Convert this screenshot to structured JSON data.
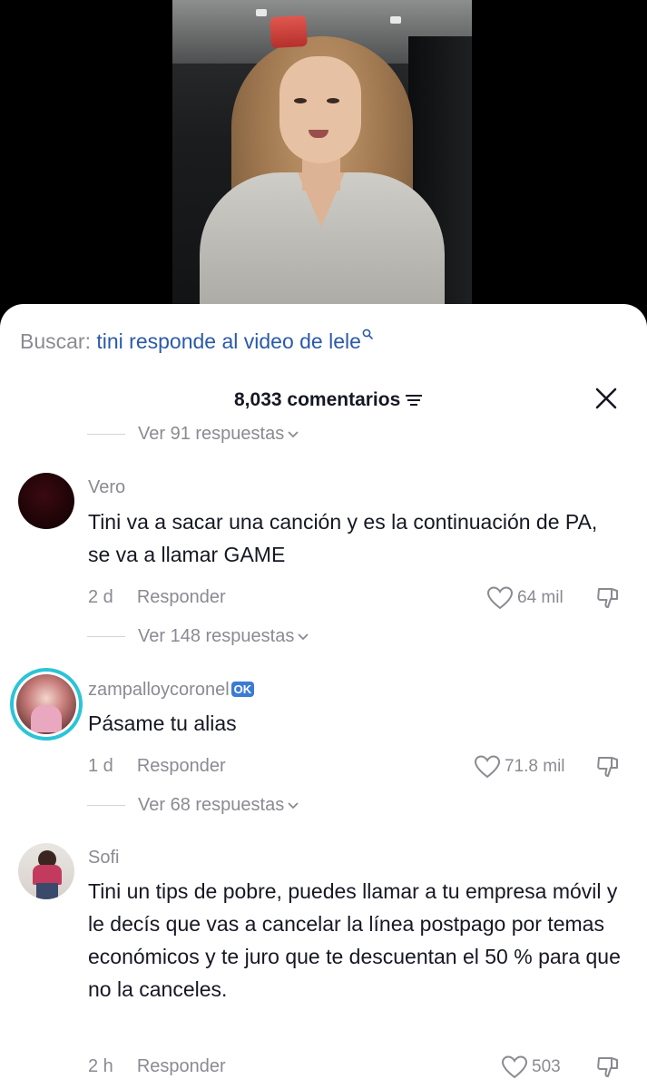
{
  "search": {
    "label": "Buscar:",
    "query": "tini responde al video de lele"
  },
  "header": {
    "count": "8,033 comentarios"
  },
  "top_replies": "Ver 91 respuestas",
  "comments": [
    {
      "author": "Vero",
      "text": "Tini va a sacar una canción y es la continuación de PA, se va a llamar GAME",
      "time": "2 d",
      "reply": "Responder",
      "likes": "64 mil",
      "replies": "Ver 148 respuestas"
    },
    {
      "author": "zampalloycoronel",
      "badge": "OK",
      "text": "Pásame tu alias",
      "time": "1 d",
      "reply": "Responder",
      "likes": "71.8 mil",
      "replies": "Ver 68 respuestas"
    },
    {
      "author": "Sofi",
      "text": "Tini un tips de pobre, puedes llamar a tu empresa móvil y le decís que vas a cancelar la línea postpago por temas económicos y te juro que te descuentan el 50 % para que no la canceles.",
      "time": "2 h",
      "reply": "Responder",
      "likes": "503"
    }
  ],
  "colors": {
    "link": "#2b5aa8",
    "muted": "#8a8b91",
    "text": "#161823",
    "story_ring": "#2bc4d6"
  },
  "icons": [
    "search-icon",
    "filter-icon",
    "close-icon",
    "chevron-down-icon",
    "heart-icon",
    "dislike-icon"
  ]
}
